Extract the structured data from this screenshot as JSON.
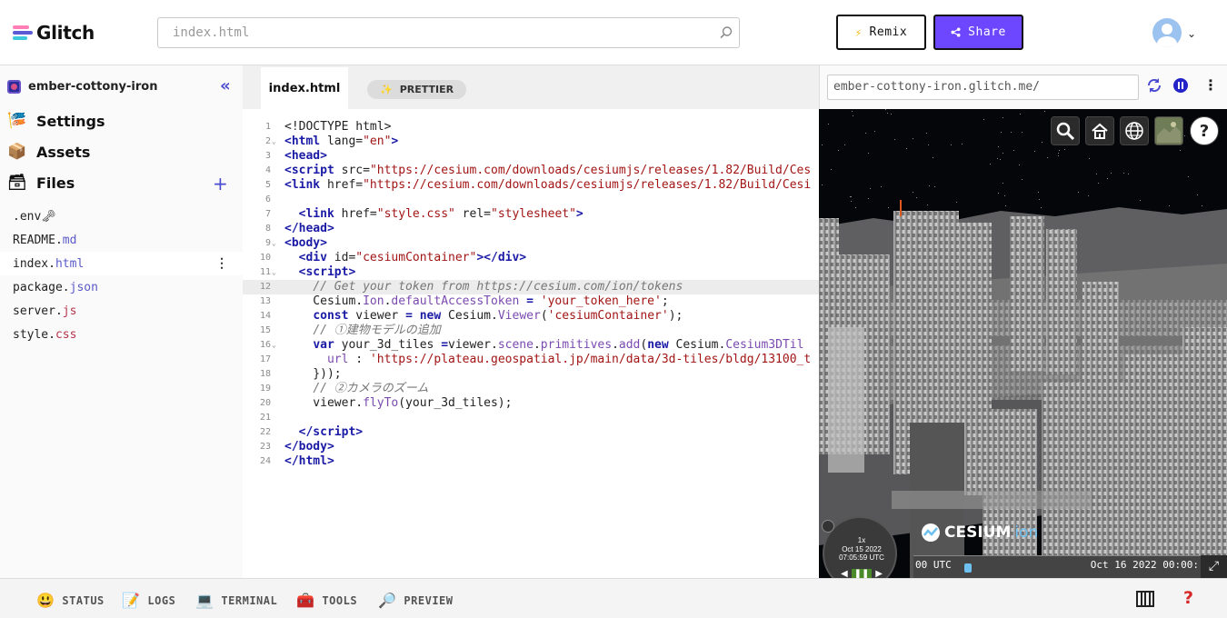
{
  "header": {
    "brand": "Glitch",
    "search_placeholder": "index.html",
    "remix_label": "Remix",
    "share_label": "Share"
  },
  "sidebar": {
    "project_name": "ember-cottony-iron",
    "nav": [
      {
        "label": "Settings",
        "icon": "settings-icon"
      },
      {
        "label": "Assets",
        "icon": "assets-box-icon"
      },
      {
        "label": "Files",
        "icon": "files-icon"
      }
    ],
    "files": [
      {
        "base": ".env",
        "ext": "",
        "suffix": " 🗝"
      },
      {
        "base": "README.",
        "ext": "md"
      },
      {
        "base": "index.",
        "ext": "html"
      },
      {
        "base": "package.",
        "ext": "json"
      },
      {
        "base": "server.",
        "ext": "js"
      },
      {
        "base": "style.",
        "ext": "css"
      }
    ],
    "active_file_index": 2
  },
  "editor": {
    "tab_label": "index.html",
    "prettier_label": "PRETTIER",
    "highlighted_line": 12,
    "lines": [
      {
        "n": "1",
        "fold": "",
        "html": "&lt;!DOCTYPE html&gt;"
      },
      {
        "n": "2",
        "fold": "v",
        "html": "<span class=\"tg\">&lt;html</span> lang=<span class=\"s\">\"en\"</span><span class=\"tg\">&gt;</span>"
      },
      {
        "n": "3",
        "fold": "",
        "html": "<span class=\"tg\">&lt;head&gt;</span>"
      },
      {
        "n": "4",
        "fold": "",
        "html": "<span class=\"tg\">&lt;script</span> src=<span class=\"s\">\"https://cesium.com/downloads/cesiumjs/releases/1.82/Build/Ces</span>"
      },
      {
        "n": "5",
        "fold": "",
        "html": "<span class=\"tg\">&lt;link</span> href=<span class=\"s\">\"https://cesium.com/downloads/cesiumjs/releases/1.82/Build/Cesi</span>"
      },
      {
        "n": "6",
        "fold": "",
        "html": ""
      },
      {
        "n": "7",
        "fold": "",
        "html": "  <span class=\"tg\">&lt;link</span> href=<span class=\"s\">\"style.css\"</span> rel=<span class=\"s\">\"stylesheet\"</span><span class=\"tg\">&gt;</span>"
      },
      {
        "n": "8",
        "fold": "",
        "html": "<span class=\"tg\">&lt;/head&gt;</span>"
      },
      {
        "n": "9",
        "fold": "v",
        "html": "<span class=\"tg\">&lt;body&gt;</span>"
      },
      {
        "n": "10",
        "fold": "",
        "html": "  <span class=\"tg\">&lt;div</span> id=<span class=\"s\">\"cesiumContainer\"</span><span class=\"tg\">&gt;&lt;/div&gt;</span>"
      },
      {
        "n": "11",
        "fold": "v",
        "html": "  <span class=\"tg\">&lt;script&gt;</span>"
      },
      {
        "n": "12",
        "fold": "",
        "html": "    <span class=\"c\">// Get your token from https://cesium.com/ion/tokens</span>"
      },
      {
        "n": "13",
        "fold": "",
        "html": "    Cesium.<span class=\"m\">Ion</span>.<span class=\"m\">defaultAccessToken</span> <span class=\"k\">=</span> <span class=\"s\">'your_token_here'</span>;"
      },
      {
        "n": "14",
        "fold": "",
        "html": "    <span class=\"k\">const</span> viewer <span class=\"k\">= new</span> Cesium.<span class=\"m\">Viewer</span>(<span class=\"s\">'cesiumContainer'</span>);"
      },
      {
        "n": "15",
        "fold": "",
        "html": "    <span class=\"c\">// ①建物モデルの追加</span>"
      },
      {
        "n": "16",
        "fold": "v",
        "html": "    <span class=\"k\">var</span> your_3d_tiles <span class=\"k\">=</span>viewer.<span class=\"m\">scene</span>.<span class=\"m\">primitives</span>.<span class=\"m\">add</span>(<span class=\"k\">new</span> Cesium.<span class=\"m\">Cesium3DTil</span>"
      },
      {
        "n": "17",
        "fold": "",
        "html": "      <span class=\"m\">url</span> : <span class=\"s\">'https://plateau.geospatial.jp/main/data/3d-tiles/bldg/13100_t</span>"
      },
      {
        "n": "18",
        "fold": "",
        "html": "    }));"
      },
      {
        "n": "19",
        "fold": "",
        "html": "    <span class=\"c\">// ②カメラのズーム</span>"
      },
      {
        "n": "20",
        "fold": "",
        "html": "    viewer.<span class=\"m\">flyTo</span>(your_3d_tiles);"
      },
      {
        "n": "21",
        "fold": "",
        "html": ""
      },
      {
        "n": "22",
        "fold": "",
        "html": "  <span class=\"tg\">&lt;/script&gt;</span>"
      },
      {
        "n": "23",
        "fold": "",
        "html": "<span class=\"tg\">&lt;/body&gt;</span>"
      },
      {
        "n": "24",
        "fold": "",
        "html": "<span class=\"tg\">&lt;/html&gt;</span>"
      }
    ]
  },
  "preview": {
    "url": "ember-cottony-iron.glitch.me/",
    "cesium_brand": "CESIUM",
    "cesium_ion": "ion",
    "clock_speed": "1x",
    "clock_date": "Oct 15 2022",
    "clock_time": "07:05:59 UTC",
    "timeline_start": "00 UTC",
    "timeline_end": "Oct 16 2022 00:00:"
  },
  "footer": {
    "items": [
      {
        "label": "STATUS",
        "icon": "status-smile-icon"
      },
      {
        "label": "LOGS",
        "icon": "logs-icon"
      },
      {
        "label": "TERMINAL",
        "icon": "terminal-icon"
      },
      {
        "label": "TOOLS",
        "icon": "toolbox-icon"
      },
      {
        "label": "PREVIEW",
        "icon": "preview-magnifier-icon"
      }
    ]
  },
  "colors": {
    "accent": "#6c47ff",
    "link_blue": "#4a4ad0"
  }
}
